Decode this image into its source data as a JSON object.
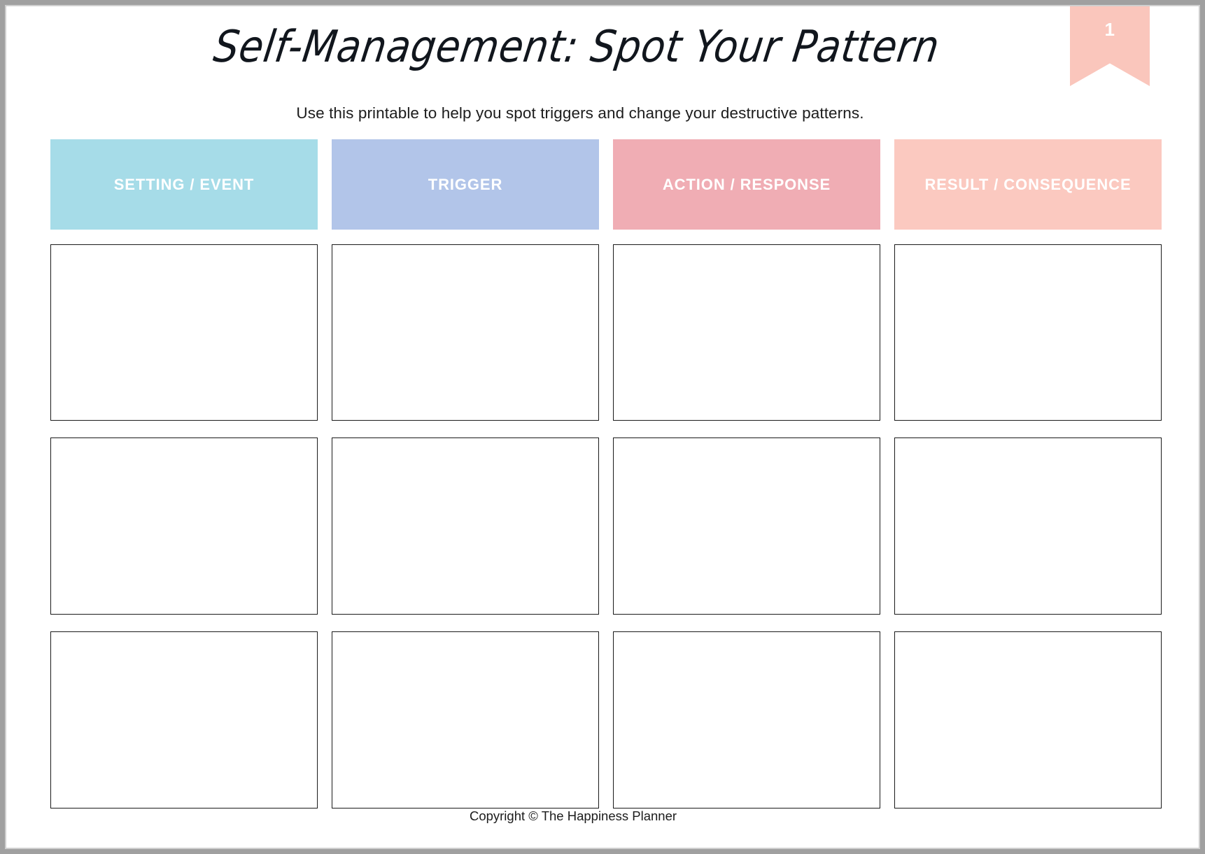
{
  "page": {
    "badge_number": "1",
    "badge_color": "#fac6bc",
    "title": "Self-Management: Spot Your Pattern",
    "subtitle": "Use this printable to help you spot triggers and change your destructive patterns.",
    "footer": "Copyright © The Happiness Planner"
  },
  "columns": [
    {
      "label": "SETTING / EVENT",
      "color": "#a6dce8"
    },
    {
      "label": "TRIGGER",
      "color": "#b2c5e9"
    },
    {
      "label": "ACTION / RESPONSE",
      "color": "#f0adb4"
    },
    {
      "label": "RESULT / CONSEQUENCE",
      "color": "#fbc9c0"
    }
  ],
  "rows": [
    {
      "cells": [
        "",
        "",
        "",
        ""
      ]
    },
    {
      "cells": [
        "",
        "",
        "",
        ""
      ]
    },
    {
      "cells": [
        "",
        "",
        "",
        ""
      ]
    }
  ]
}
